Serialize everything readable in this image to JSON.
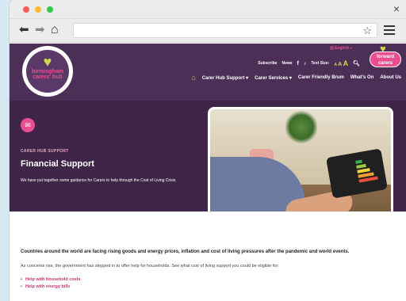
{
  "window": {
    "close_glyph": "×"
  },
  "browser": {
    "back_icon": "arrow-left-icon",
    "forward_icon": "arrow-right-icon",
    "home_icon": "home-icon",
    "url": "",
    "star_glyph": "☆",
    "menu_icon": "hamburger-menu-icon"
  },
  "header": {
    "logo_text_line1": "birmingham",
    "logo_text_line2": "carers' hub",
    "language": "English",
    "utility": {
      "subscribe": "Subscribe",
      "news": "News",
      "facebook": "f",
      "tiktok": "♪",
      "text_size_label": "Text Size:",
      "size_small": "A",
      "size_medium": "A",
      "size_large": "A"
    },
    "partner_logo_line1": "forward",
    "partner_logo_line2": "carers",
    "nav": [
      "Carer Hub Support ▾",
      "Carer Services ▾",
      "Carer Friendly Brum",
      "What's On",
      "About Us"
    ]
  },
  "hero": {
    "eyebrow": "CARER HUB SUPPORT",
    "title": "Financial Support",
    "text": "We have put together some guidance for Carers to help through the Cost of Living Crisis."
  },
  "content": {
    "lead": "Countries around the world are facing rising goods and energy prices, inflation and cost of living pressures after the pandemic and world events.",
    "para": "As concerns rise, the government has stepped in to offer help for households. See what cost of living support you could be eligible for:",
    "links": [
      "Help with household costs",
      "Help with energy bills"
    ]
  },
  "colors": {
    "brand_purple": "#4b2f57",
    "hero_purple": "#3f2648",
    "accent_pink": "#e94f90",
    "accent_lime": "#cfd94a",
    "link_pink": "#c8356e"
  }
}
